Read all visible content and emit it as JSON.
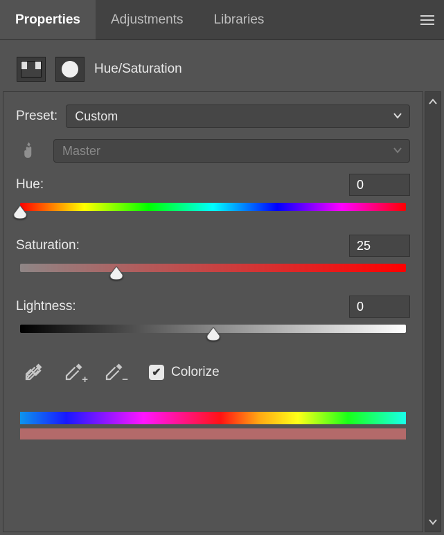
{
  "tabs": {
    "properties": "Properties",
    "adjustments": "Adjustments",
    "libraries": "Libraries"
  },
  "title": "Hue/Saturation",
  "preset": {
    "label": "Preset:",
    "value": "Custom"
  },
  "channel": {
    "value": "Master"
  },
  "hue": {
    "label": "Hue:",
    "value": "0",
    "thumb_pct": 0
  },
  "saturation": {
    "label": "Saturation:",
    "value": "25",
    "thumb_pct": 25
  },
  "lightness": {
    "label": "Lightness:",
    "value": "0",
    "thumb_pct": 50
  },
  "colorize": {
    "label": "Colorize",
    "checked": true
  }
}
